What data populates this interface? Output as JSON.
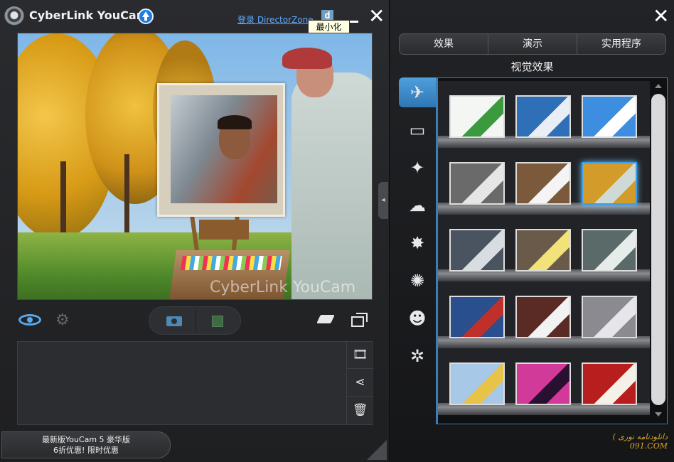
{
  "app": {
    "title": "CyberLink YouCam",
    "login_link": "登录 DirectorZone",
    "directorzone_icon": "d",
    "tooltip": "最小化",
    "close_glyph": "✕",
    "watermark": "CyberLink YouCam"
  },
  "left_toolbar": {
    "eye_icon": "eye-icon",
    "gear_icon": "⚙",
    "camera_icon": "camera-icon",
    "record_icon": "record-icon",
    "eraser_icon": "eraser-icon",
    "resize_icon": "window-resize-icon"
  },
  "tray_buttons": [
    {
      "name": "filmstrip-icon",
      "glyph": "🎞"
    },
    {
      "name": "share-icon",
      "glyph": "⋖"
    },
    {
      "name": "trash-icon",
      "glyph": "🗑"
    }
  ],
  "promo": {
    "line1": "最新版YouCam 5 豪华版",
    "line2": "6折优惠! 限时优惠"
  },
  "collapse_glyph": "◂",
  "right_panel": {
    "close_glyph": "✕",
    "tabs": [
      "效果",
      "演示",
      "实用程序"
    ],
    "section_title": "视觉效果",
    "categories": [
      {
        "name": "scene-effect-icon",
        "glyph": "✈",
        "active": true
      },
      {
        "name": "frame-icon",
        "glyph": "▭"
      },
      {
        "name": "magic-wand-icon",
        "glyph": "✦"
      },
      {
        "name": "mask-icon",
        "glyph": "☁"
      },
      {
        "name": "distortion-icon",
        "glyph": "✸"
      },
      {
        "name": "particle-icon",
        "glyph": "✺"
      },
      {
        "name": "emoticon-icon",
        "glyph": "☻"
      },
      {
        "name": "gadget-icon",
        "glyph": "✲"
      }
    ],
    "rows": [
      [
        {
          "name": "download-more-effects",
          "color": "#f3f6f2",
          "accent": "#3b9a3e"
        },
        {
          "name": "effect-city-sign",
          "color": "#2f6fb8",
          "accent": "#e9eef5"
        },
        {
          "name": "effect-balloons",
          "color": "#3d8de0",
          "accent": "#ffffff"
        }
      ],
      [
        {
          "name": "effect-street-billboard",
          "color": "#6a6a6a",
          "accent": "#e6e6e6"
        },
        {
          "name": "effect-hold-paper",
          "color": "#7a5a3a",
          "accent": "#f4f4f4"
        },
        {
          "name": "effect-painter-easel",
          "color": "#d29b2a",
          "accent": "#cfd9d5",
          "selected": true
        }
      ],
      [
        {
          "name": "effect-station-screen",
          "color": "#4a5460",
          "accent": "#d8dde2"
        },
        {
          "name": "effect-times-square",
          "color": "#6a5a4a",
          "accent": "#f1e37a"
        },
        {
          "name": "effect-window-cleaners",
          "color": "#5a6a68",
          "accent": "#e5ecea"
        }
      ],
      [
        {
          "name": "effect-red-bus-screen",
          "color": "#294f8f",
          "accent": "#c0302b"
        },
        {
          "name": "effect-stage-screen",
          "color": "#5a2a24",
          "accent": "#f2f2f2"
        },
        {
          "name": "effect-building-screens",
          "color": "#8a8a90",
          "accent": "#e6e6ea"
        }
      ],
      [
        {
          "name": "effect-birthday-cake",
          "color": "#a8c8e8",
          "accent": "#e8c34a"
        },
        {
          "name": "effect-dance-party",
          "color": "#d23a9a",
          "accent": "#2a1030"
        },
        {
          "name": "effect-love-silhouette",
          "color": "#b81e1e",
          "accent": "#f5f0e8"
        }
      ]
    ]
  },
  "brand": {
    "line1": "( دانلودنامه نوری",
    "line2": "091.COM"
  }
}
